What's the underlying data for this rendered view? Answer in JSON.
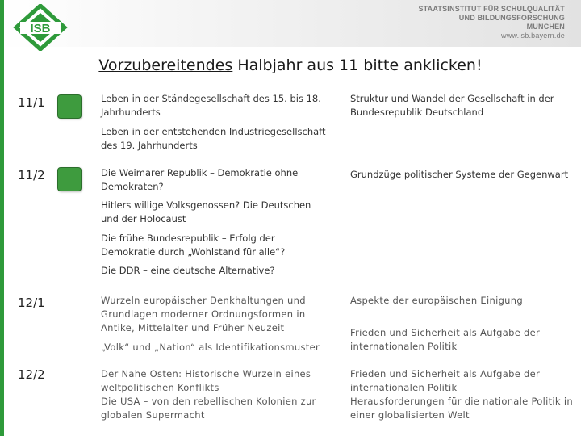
{
  "header": {
    "logo_text": "ISB",
    "institute_line1": "STAATSINSTITUT FÜR SCHULQUALITÄT",
    "institute_line2": "UND BILDUNGSFORSCHUNG",
    "institute_line3": "MÜNCHEN",
    "institute_url": "www.isb.bayern.de",
    "colors": {
      "brand_green": "#2e9a3a",
      "button_green": "#3e9b3e"
    }
  },
  "title": {
    "part1": "Vorzubereitendes",
    "part2": " Halbjahr aus 11 bitte anklicken!"
  },
  "rows": {
    "r111": {
      "label": "11/1",
      "col1": [
        "Leben in der Ständegesellschaft des 15. bis 18. Jahrhunderts",
        "Leben in der entstehenden Industriegesellschaft des 19. Jahrhunderts"
      ],
      "col2": [
        "Struktur und Wandel der Gesellschaft in der Bundesrepublik Deutschland"
      ]
    },
    "r112": {
      "label": "11/2",
      "col1": [
        "Die Weimarer Republik – Demokratie ohne Demokraten?",
        "Hitlers willige Volksgenossen? Die Deutschen und der Holocaust",
        "Die frühe Bundesrepublik – Erfolg der Demokratie durch „Wohlstand für alle“?",
        "Die DDR – eine deutsche Alternative?"
      ],
      "col2": [
        "Grundzüge politischer Systeme der Gegenwart"
      ]
    },
    "r121": {
      "label": "12/1",
      "col1": [
        "Wurzeln europäischer Denkhaltungen und Grundlagen moderner Ordnungsformen in Antike, Mittelalter und Früher Neuzeit",
        "„Volk“ und „Nation“ als Identifikationsmuster"
      ],
      "col2": [
        "Aspekte der europäischen Einigung",
        "Frieden und Sicherheit als Aufgabe der internationalen Politik"
      ]
    },
    "r122": {
      "label": "12/2",
      "col1": [
        "Der Nahe Osten: Historische Wurzeln eines weltpolitischen Konflikts",
        "Die USA – von den rebellischen Kolonien zur globalen Supermacht"
      ],
      "col2": [
        "Frieden und Sicherheit als Aufgabe der internationalen Politik",
        "Herausforderungen für die nationale Politik in einer globalisierten Welt"
      ]
    }
  }
}
